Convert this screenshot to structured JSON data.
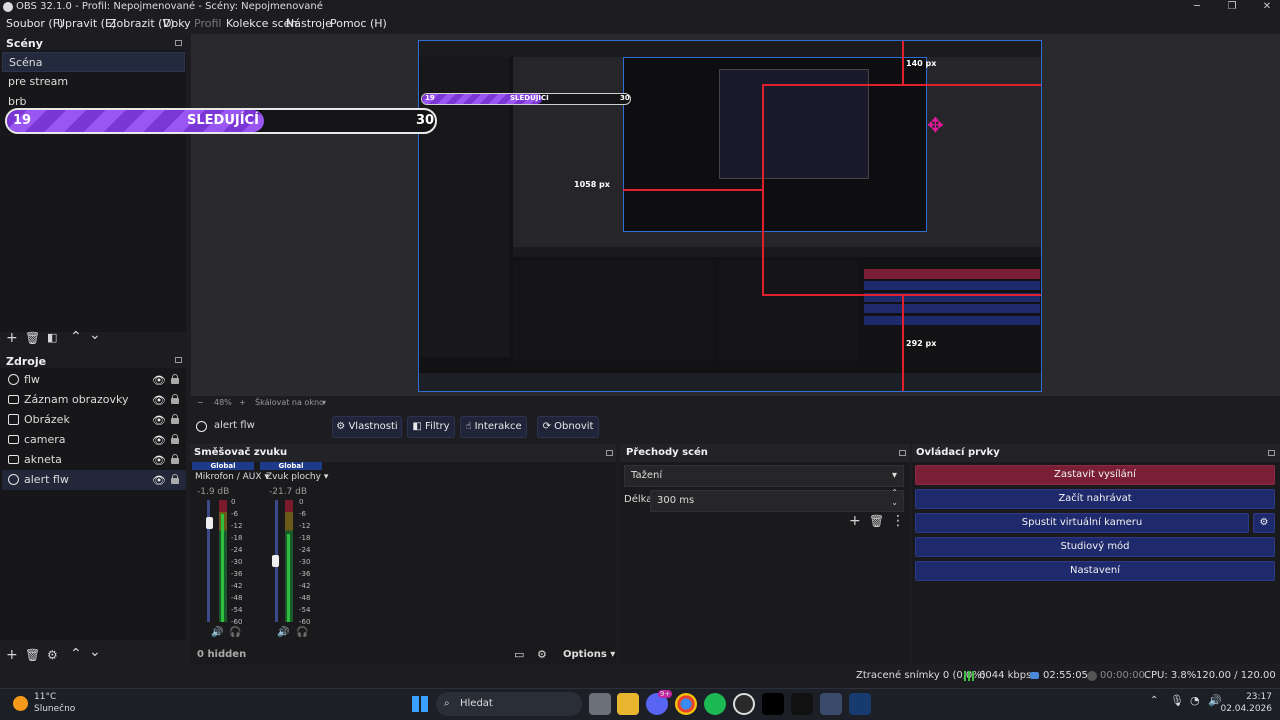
{
  "window": {
    "title": "OBS 32.1.0 - Profil: Nepojmenované - Scény: Nepojmenované"
  },
  "menu": [
    "Soubor (F)",
    "Upravit (E)",
    "Zobrazit (V)",
    "Doky",
    "Profil",
    "Kolekce scén",
    "Nástroje",
    "Pomoc (H)"
  ],
  "scenes": {
    "title": "Scény",
    "items": [
      "Scéna",
      "pre stream",
      "brb"
    ]
  },
  "sources": {
    "title": "Zdroje",
    "items": [
      "flw",
      "Záznam obrazovky",
      "Obrázek",
      "camera",
      "akneta",
      "alert flw"
    ]
  },
  "follower_bar": {
    "current": "19",
    "label": "SLEDUJÍCÍ",
    "goal": "30",
    "progress": 0.6
  },
  "preview": {
    "inner_bar": {
      "current": "19",
      "label": "SLEDUJÍCÍ",
      "goal": "30"
    },
    "guides": {
      "top": "140 px",
      "left": "1058 px",
      "bottom": "292 px"
    },
    "zoom": "48%",
    "scale_mode": "Škálovat na okno"
  },
  "context": {
    "source": "alert flw",
    "properties": "Vlastnosti",
    "filters": "Filtry",
    "interact": "Interakce",
    "refresh": "Obnovit"
  },
  "mixer": {
    "title": "Směšovač zvuku",
    "channels": [
      {
        "tag": "Global",
        "name": "Mikrofon / AUX",
        "db": "-1.9 dB",
        "level": 0.85
      },
      {
        "tag": "Global",
        "name": "Zvuk plochy",
        "db": "-21.7 dB",
        "level": 0.5
      }
    ],
    "ticks": [
      "0",
      "-6",
      "-12",
      "-18",
      "-24",
      "-30",
      "-36",
      "-42",
      "-48",
      "-54",
      "-60"
    ],
    "hidden": "0 hidden",
    "options": "Options"
  },
  "transitions": {
    "title": "Přechody scén",
    "type": "Tažení",
    "duration_label": "Délka",
    "duration": "300 ms"
  },
  "controls": {
    "title": "Ovládací prvky",
    "stop_stream": "Zastavit vysílání",
    "start_record": "Začít nahrávat",
    "virtual_cam": "Spustit virtuální kameru",
    "studio": "Studiový mód",
    "settings": "Nastavení"
  },
  "status": {
    "dropped": "Ztracené snímky 0 (0,0%)",
    "bitrate": "6044 kbps",
    "stream_time": "02:55:05",
    "rec_time": "00:00:00",
    "cpu": "CPU: 3.8%",
    "fps": "120.00 / 120.00 FPS"
  },
  "taskbar": {
    "temp": "11°C",
    "weather": "Slunečno",
    "search": "Hledat",
    "time": "23:17",
    "date": "02.04.2026",
    "badge": "9+"
  },
  "colors": {
    "accent": "#1e2a6b",
    "stop": "#7a1f36",
    "bar": "#8a3ee0",
    "guide": "#e0202c"
  }
}
